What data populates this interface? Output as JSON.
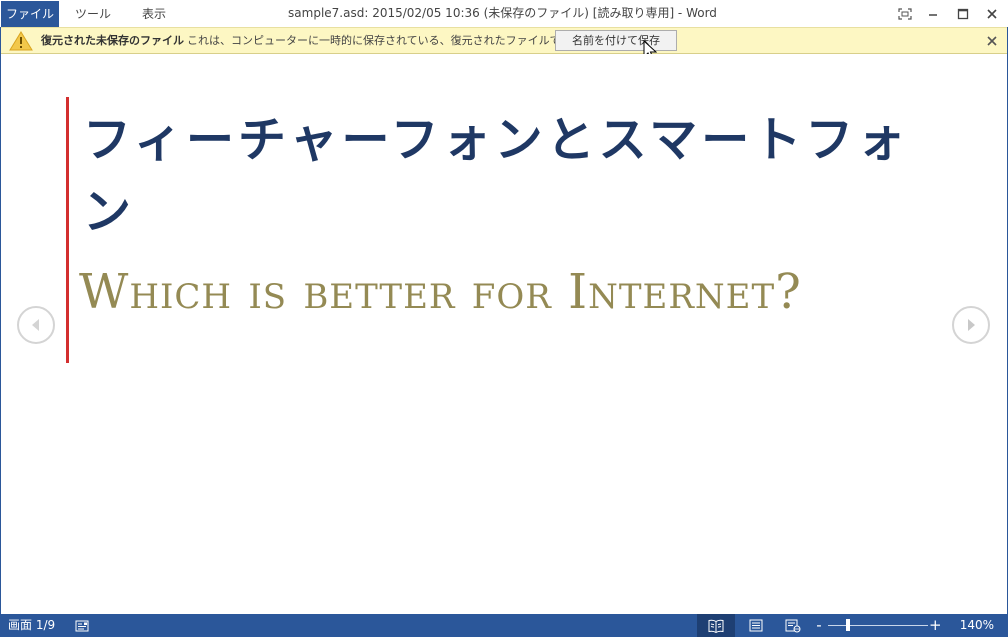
{
  "titlebar": {
    "menu_file": "ファイル",
    "menu_tools": "ツール",
    "menu_view": "表示",
    "doc_title": "sample7.asd: 2015/02/05 10:36 (未保存のファイル) [読み取り専用] - Word",
    "icons": [
      "fullscreen-icon",
      "minimize-icon",
      "maximize-icon",
      "close-icon"
    ]
  },
  "infobar": {
    "icon": "warning-icon",
    "title": "復元された未保存のファイル",
    "message": "これは、コンピューターに一時的に保存されている、復元されたファイルです。",
    "save_as_label": "名前を付けて保存",
    "close_icon": "close-icon"
  },
  "document": {
    "heading": "フィーチャーフォンとスマートフォン",
    "subtitle": "Which is better for Internet?",
    "accent_bar_color": "#d32f2f",
    "heading_color": "#1f3864",
    "subtitle_color": "#948a54"
  },
  "statusbar": {
    "page_info": "画面 1/9",
    "zoom_minus": "-",
    "zoom_plus": "+",
    "zoom_level": "140%",
    "zoom_value_percent": 140,
    "background_color": "#2b579a"
  }
}
